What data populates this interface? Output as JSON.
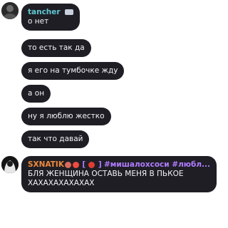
{
  "messages": [
    {
      "author": "tancher",
      "text": "о нет"
    },
    {
      "text": "то есть так да"
    },
    {
      "text": "я его на тумбочке жду"
    },
    {
      "text": "а он"
    },
    {
      "text": "ну я люблю жестко"
    },
    {
      "text": "так что давай"
    }
  ],
  "last_message": {
    "author": "SXNATIK",
    "bracket_open": "[",
    "bracket_close": "]",
    "tag": "#мишалохсоси #любл...",
    "line1": "БЛЯ ЖЕНЩИНА ОСТАВЬ МЕНЯ В ПЬКОЕ",
    "line2": "ХАХАХАХАХАХАХ"
  },
  "colors": {
    "bubble": "#1f1e25",
    "author_teal": "#5fc6d2",
    "author_orange": "#ef8a3c",
    "tag_purple": "#b07cff"
  },
  "icons": [
    "user-avatar-icon",
    "badge-icon",
    "sushi-emoji-icon",
    "fire-emoji-icon",
    "tomato-emoji-icon"
  ]
}
